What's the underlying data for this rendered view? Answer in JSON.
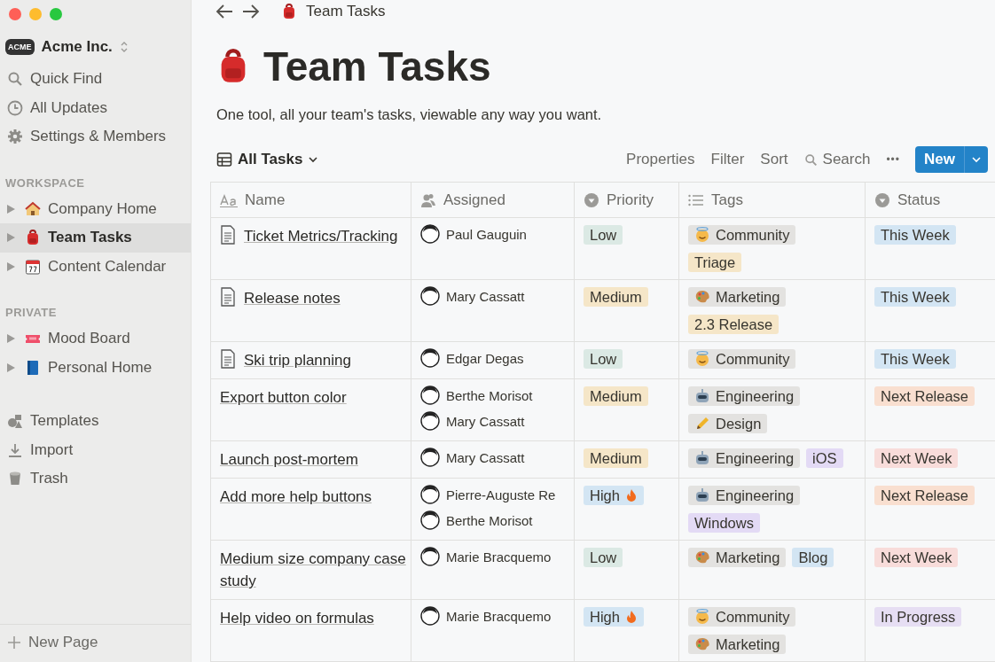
{
  "workspace": {
    "name": "Acme Inc.",
    "logo": "ACME"
  },
  "nav": [
    {
      "label": "Quick Find",
      "kind": "search"
    },
    {
      "label": "All Updates",
      "kind": "clock"
    },
    {
      "label": "Settings & Members",
      "kind": "gear"
    }
  ],
  "sections": [
    {
      "heading": "WORKSPACE",
      "pages": [
        {
          "label": "Company Home",
          "kind": "house",
          "selected": false
        },
        {
          "label": "Team Tasks",
          "kind": "backpack",
          "selected": true
        },
        {
          "label": "Content Calendar",
          "kind": "calendar",
          "selected": false
        }
      ]
    },
    {
      "heading": "PRIVATE",
      "pages": [
        {
          "label": "Mood Board",
          "kind": "ticket",
          "selected": false
        },
        {
          "label": "Personal Home",
          "kind": "book",
          "selected": false
        }
      ]
    }
  ],
  "tools": [
    {
      "label": "Templates",
      "kind": "shapes"
    },
    {
      "label": "Import",
      "kind": "download"
    },
    {
      "label": "Trash",
      "kind": "bin"
    }
  ],
  "new_page": "New Page",
  "breadcrumb": "Team Tasks",
  "page": {
    "title": "Team Tasks",
    "description": "One tool, all your team's tasks, viewable any way you want."
  },
  "view": {
    "label": "All Tasks",
    "actions": [
      "Properties",
      "Filter",
      "Sort"
    ],
    "search": "Search",
    "more": "•••",
    "new_button": "New"
  },
  "table": {
    "columns": [
      {
        "label": "Name",
        "kind": "text"
      },
      {
        "label": "Assigned",
        "kind": "person"
      },
      {
        "label": "Priority",
        "kind": "select"
      },
      {
        "label": "Tags",
        "kind": "multi"
      },
      {
        "label": "Status",
        "kind": "select"
      }
    ],
    "rows": [
      {
        "name": "Ticket Metrics/Tracking",
        "doc": true,
        "assigned": [
          "Paul Gauguin"
        ],
        "priority": {
          "label": "Low",
          "flame": false,
          "color": "#dbe9e4"
        },
        "tags": [
          {
            "label": "Community",
            "kind": "halo",
            "color": "#e3e2e0"
          },
          {
            "label": "Triage",
            "kind": "plain",
            "color": "#f5e6c8"
          }
        ],
        "status": {
          "label": "This Week",
          "color": "#d3e5f3"
        }
      },
      {
        "name": "Release notes",
        "doc": true,
        "assigned": [
          "Mary Cassatt"
        ],
        "priority": {
          "label": "Medium",
          "flame": false,
          "color": "#f5e6c8"
        },
        "tags": [
          {
            "label": "Marketing",
            "kind": "palette",
            "color": "#e3e2e0"
          },
          {
            "label": "2.3 Release",
            "kind": "plain",
            "color": "#f5e6c8"
          }
        ],
        "status": {
          "label": "This Week",
          "color": "#d3e5f3"
        }
      },
      {
        "name": "Ski trip planning",
        "doc": true,
        "assigned": [
          "Edgar Degas"
        ],
        "priority": {
          "label": "Low",
          "flame": false,
          "color": "#dbe9e4"
        },
        "tags": [
          {
            "label": "Community",
            "kind": "halo",
            "color": "#e3e2e0"
          }
        ],
        "status": {
          "label": "This Week",
          "color": "#d3e5f3"
        }
      },
      {
        "name": "Export button color",
        "doc": false,
        "assigned": [
          "Berthe Morisot",
          "Mary Cassatt"
        ],
        "priority": {
          "label": "Medium",
          "flame": false,
          "color": "#f5e6c8"
        },
        "tags": [
          {
            "label": "Engineering",
            "kind": "robot",
            "color": "#e3e2e0"
          },
          {
            "label": "Design",
            "kind": "pencil",
            "color": "#e3e2e0"
          }
        ],
        "status": {
          "label": "Next Release",
          "color": "#f9dfd0"
        }
      },
      {
        "name": "Launch post-mortem",
        "doc": false,
        "assigned": [
          "Mary Cassatt"
        ],
        "priority": {
          "label": "Medium",
          "flame": false,
          "color": "#f5e6c8"
        },
        "tags": [
          {
            "label": "Engineering",
            "kind": "robot",
            "color": "#e3e2e0"
          },
          {
            "label": "iOS",
            "kind": "plain",
            "color": "#e3daf5"
          }
        ],
        "status": {
          "label": "Next Week",
          "color": "#f8dcda"
        }
      },
      {
        "name": "Add more help buttons",
        "doc": false,
        "assigned": [
          "Pierre-Auguste Re",
          "Berthe Morisot"
        ],
        "priority": {
          "label": "High",
          "flame": true,
          "color": "#d3e5f3"
        },
        "tags": [
          {
            "label": "Engineering",
            "kind": "robot",
            "color": "#e3e2e0"
          },
          {
            "label": "Windows",
            "kind": "plain",
            "color": "#e3daf5"
          }
        ],
        "status": {
          "label": "Next Release",
          "color": "#f9dfd0"
        }
      },
      {
        "name": "Medium size company case study",
        "doc": false,
        "assigned": [
          "Marie Bracquemo"
        ],
        "priority": {
          "label": "Low",
          "flame": false,
          "color": "#dbe9e4"
        },
        "tags": [
          {
            "label": "Marketing",
            "kind": "palette",
            "color": "#e3e2e0"
          },
          {
            "label": "Blog",
            "kind": "plain",
            "color": "#d3e5f3"
          }
        ],
        "status": {
          "label": "Next Week",
          "color": "#f8dcda"
        }
      },
      {
        "name": "Help video on formulas",
        "doc": false,
        "assigned": [
          "Marie Bracquemo"
        ],
        "priority": {
          "label": "High",
          "flame": true,
          "color": "#d3e5f3"
        },
        "tags": [
          {
            "label": "Community",
            "kind": "halo",
            "color": "#e3e2e0"
          },
          {
            "label": "Marketing",
            "kind": "palette",
            "color": "#e3e2e0"
          }
        ],
        "status": {
          "label": "In Progress",
          "color": "#e6def3"
        }
      }
    ]
  }
}
